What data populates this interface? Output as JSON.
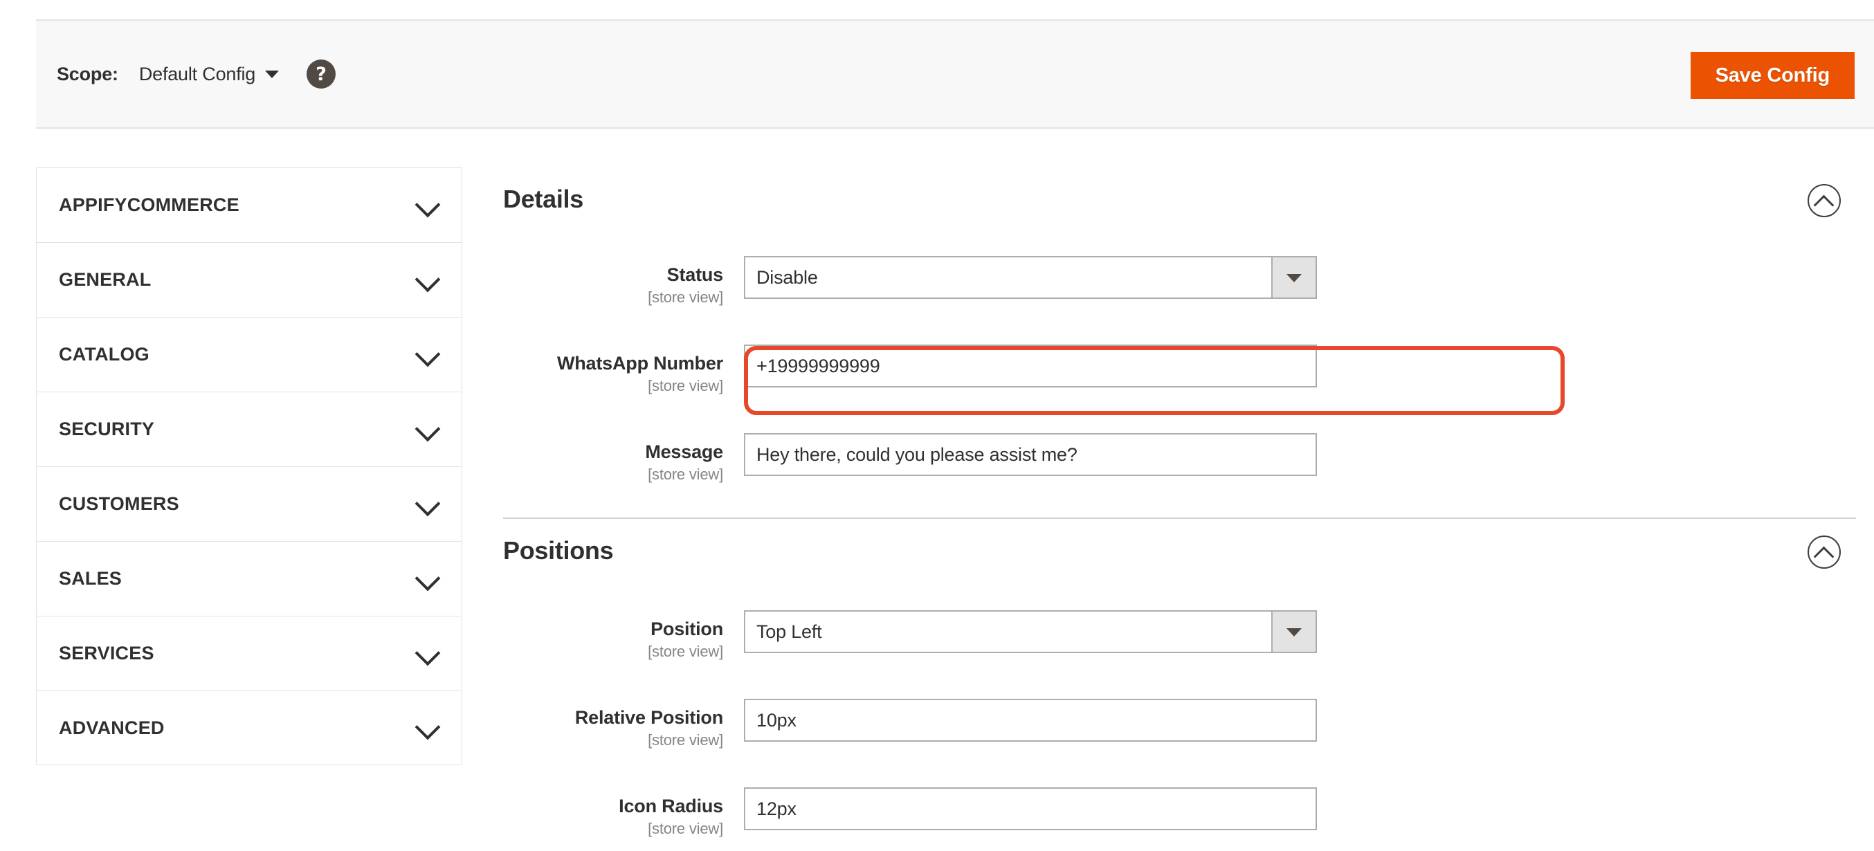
{
  "header": {
    "scope_label": "Scope:",
    "scope_value": "Default Config",
    "help_icon_glyph": "?",
    "save_label": "Save Config",
    "accent_color": "#eb5202"
  },
  "sidebar": {
    "items": [
      {
        "label": "APPIFYCOMMERCE"
      },
      {
        "label": "GENERAL"
      },
      {
        "label": "CATALOG"
      },
      {
        "label": "SECURITY"
      },
      {
        "label": "CUSTOMERS"
      },
      {
        "label": "SALES"
      },
      {
        "label": "SERVICES"
      },
      {
        "label": "ADVANCED"
      }
    ]
  },
  "sections": [
    {
      "title": "Details",
      "fields": [
        {
          "label": "Status",
          "scope": "[store view]",
          "type": "select",
          "value": "Disable"
        },
        {
          "label": "WhatsApp Number",
          "scope": "[store view]",
          "type": "text",
          "value": "+19999999999"
        },
        {
          "label": "Message",
          "scope": "[store view]",
          "type": "text",
          "value": "Hey there, could you please assist me?"
        }
      ]
    },
    {
      "title": "Positions",
      "fields": [
        {
          "label": "Position",
          "scope": "[store view]",
          "type": "select",
          "value": "Top Left"
        },
        {
          "label": "Relative Position",
          "scope": "[store view]",
          "type": "text",
          "value": "10px"
        },
        {
          "label": "Icon Radius",
          "scope": "[store view]",
          "type": "text",
          "value": "12px"
        }
      ]
    }
  ],
  "annotation": {
    "highlight_color": "#e8482a",
    "target_field": "WhatsApp Number"
  }
}
